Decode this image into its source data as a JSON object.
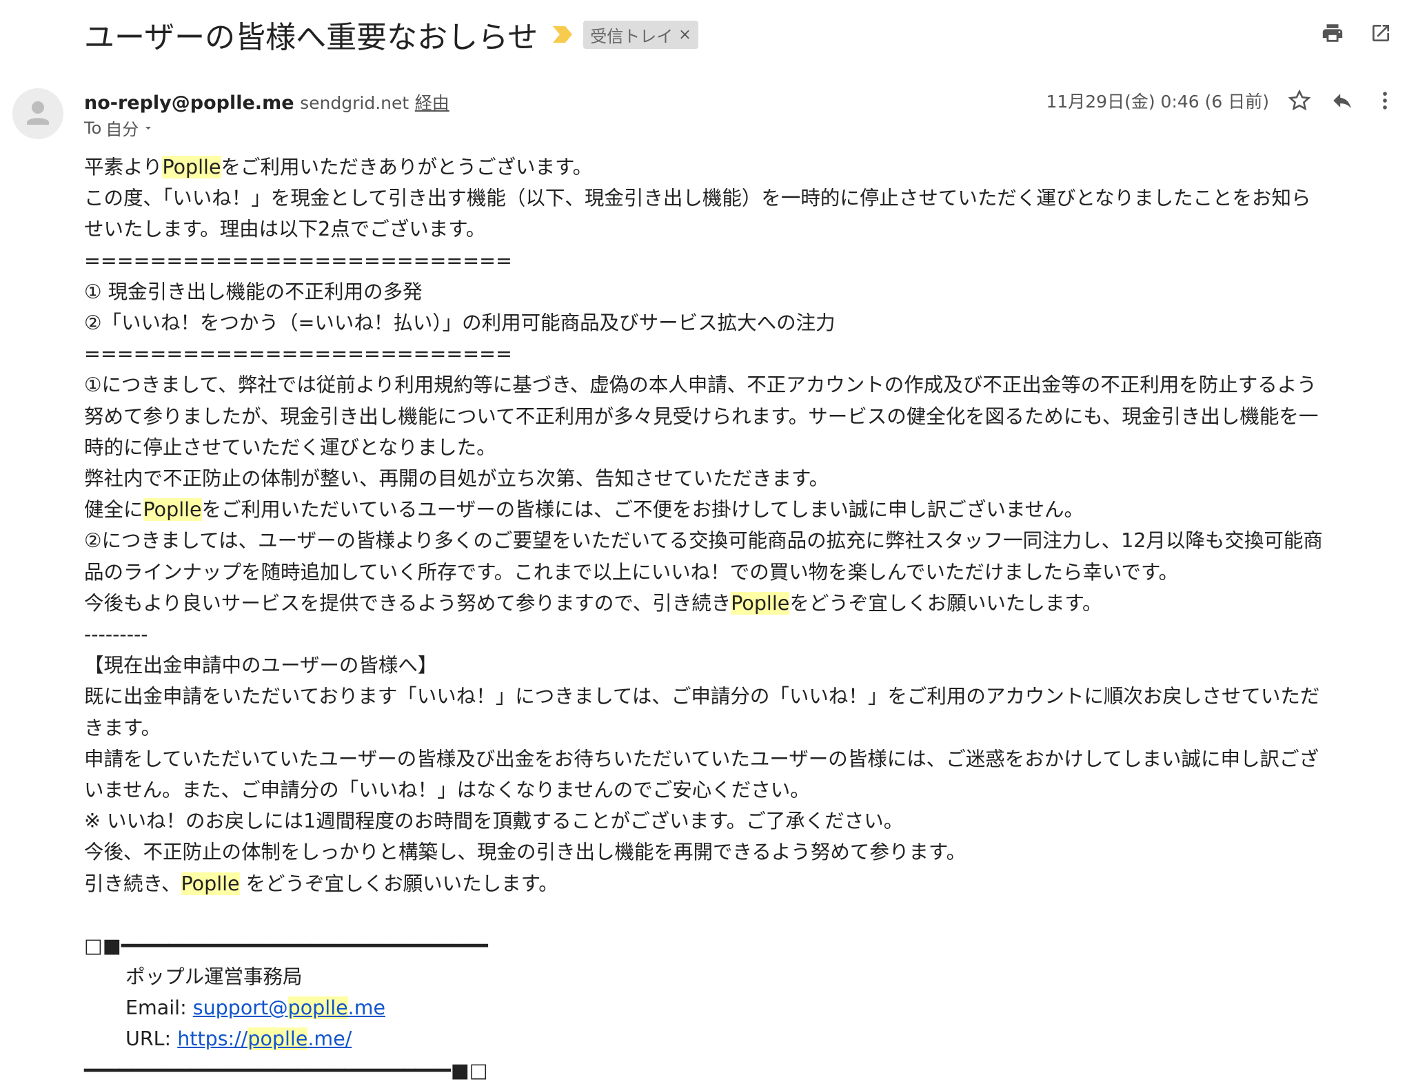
{
  "header": {
    "subject": "ユーザーの皆様へ重要なおしらせ",
    "label": "受信トレイ",
    "label_remove": "×",
    "icons": [
      "print-icon",
      "open-in-new-window-icon"
    ]
  },
  "message": {
    "sender_name": "no-reply@poplle.me",
    "sender_domain": "sendgrid.net",
    "via_text": "経由",
    "to_prefix": "To",
    "to_value": "自分",
    "date": "11月29日(金) 0:46 (6 日前)",
    "icons": [
      "star-icon",
      "reply-icon",
      "more-vert-icon"
    ]
  },
  "body": {
    "greet_pre": "平素より",
    "brand": "Poplle",
    "greet_post": "をご利用いただきありがとうございます。",
    "announce_1": "この度、「いいね！」を現金として引き出す機能（以下、現金引き出し機能）を一時的に停止させていただく運びとなりましたことをお知ら",
    "announce_2": "せいたします。理由は以下2点でございます。",
    "divider": "==========================",
    "reason_1": "① 現金引き出し機能の不正利用の多発",
    "reason_2": "②「いいね！をつかう（=いいね！払い）」の利用可能商品及びサービス拡大への注力",
    "p1_1": "①につきまして、弊社では従前より利用規約等に基づき、虚偽の本人申請、不正アカウントの作成及び不正出金等の不正利用を防止するよう",
    "p1_2": "努めて参りましたが、現金引き出し機能について不正利用が多々見受けられます。サービスの健全化を図るためにも、現金引き出し機能を一",
    "p1_3": "時的に停止させていただく運びとなりました。",
    "p2": "弊社内で不正防止の体制が整い、再開の目処が立ち次第、告知させていただきます。",
    "p3_pre": "健全に",
    "p3_post": "をご利用いただいているユーザーの皆様には、ご不便をお掛けしてしまい誠に申し訳ございません。",
    "p4_1": "②につきましては、ユーザーの皆様より多くのご要望をいただいてる交換可能商品の拡充に弊社スタッフ一同注力し、12月以降も交換可能商",
    "p4_2": "品のラインナップを随時追加していく所存です。これまで以上にいいね！での買い物を楽しんでいただけましたら幸いです。",
    "p5_pre": "今後もより良いサービスを提供できるよう努めて参りますので、引き続き",
    "p5_post": "をどうぞ宜しくお願いいたします。",
    "short_divider": "---------",
    "section_title": "【現在出金申請中のユーザーの皆様へ】",
    "p6_1": "既に出金申請をいただいております「いいね！」につきましては、ご申請分の「いいね！」をご利用のアカウントに順次お戻しさせていただ",
    "p6_2": "きます。",
    "p7_1": "申請をしていただいていたユーザーの皆様及び出金をお待ちいただいていたユーザーの皆様には、ご迷惑をおかけしてしまい誠に申し訳ござ",
    "p7_2": "いません。また、ご申請分の「いいね！」はなくなりませんのでご安心ください。",
    "note": "※ いいね！のお戻しには1週間程度のお時間を頂戴することがございます。ご了承ください。",
    "p8": "今後、不正防止の体制をしっかりと構築し、現金の引き出し機能を再開できるよう努めて参ります。",
    "p9_pre": "引き続き、",
    "p9_post": " をどうぞ宜しくお願いいたします。"
  },
  "signature": {
    "top_line": "□■━━━━━━━━━━━━━━━━━━━━━━━━━━━━━━━",
    "org": "ポップル運営事務局",
    "email_label": "Email: ",
    "email_a": "support@",
    "email_b": "poplle",
    "email_c": ".me",
    "url_label": "URL: ",
    "url_a": "https://",
    "url_b": "poplle",
    "url_c": ".me/",
    "bottom_line": "━━━━━━━━━━━━━━━━━━━━━━━━━━━━━━━■□"
  }
}
